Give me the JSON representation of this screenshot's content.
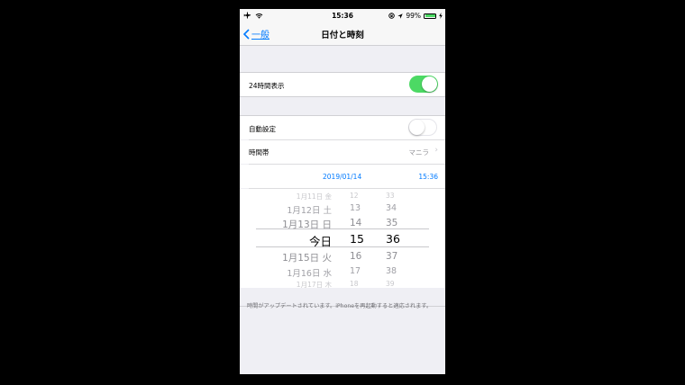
{
  "status_bar": {
    "time": "15:36",
    "battery": "99%",
    "icons": [
      "airplane-icon",
      "wifi-icon",
      "lock-rotation-icon",
      "location-icon",
      "battery-icon",
      "charging-icon"
    ]
  },
  "nav": {
    "back_label": "一般",
    "title": "日付と時刻"
  },
  "settings": {
    "hour24_label": "24時間表示",
    "hour24_on": true,
    "auto_label": "自動設定",
    "auto_on": false,
    "timezone_label": "時間帯",
    "timezone_value": "マニラ",
    "date_value": "2019/01/14",
    "time_value": "15:36"
  },
  "picker": {
    "rows": [
      {
        "date": "1月11日 金",
        "hour": "12",
        "minute": "33"
      },
      {
        "date": "1月12日 土",
        "hour": "13",
        "minute": "34"
      },
      {
        "date": "1月13日 日",
        "hour": "14",
        "minute": "35"
      },
      {
        "date": "今日",
        "hour": "15",
        "minute": "36"
      },
      {
        "date": "1月15日 火",
        "hour": "16",
        "minute": "37"
      },
      {
        "date": "1月16日 水",
        "hour": "17",
        "minute": "38"
      },
      {
        "date": "1月17日 木",
        "hour": "18",
        "minute": "39"
      }
    ]
  },
  "footer_text": "時間がアップデートされています。iPhoneを再起動すると適応されます。",
  "colors": {
    "accent": "#007aff",
    "toggle_on": "#4cd964",
    "background": "#efeff4"
  }
}
